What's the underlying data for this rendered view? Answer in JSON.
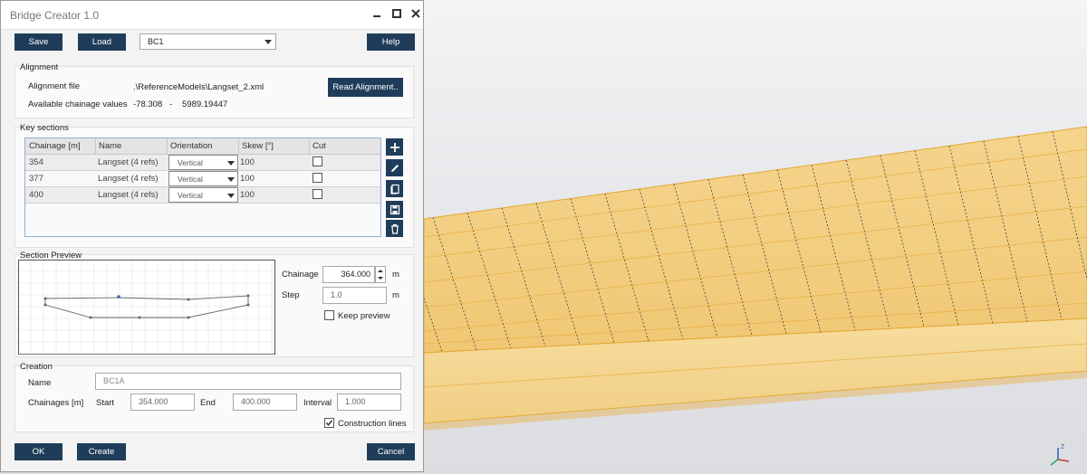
{
  "window": {
    "title": "Bridge Creator 1.0"
  },
  "toolbar": {
    "save_label": "Save",
    "load_label": "Load",
    "preset_value": "BC1",
    "help_label": "Help"
  },
  "alignment": {
    "group_label": "Alignment",
    "file_label": "Alignment file",
    "file_value": ".\\ReferenceModels\\Langset_2.xml",
    "chainage_label": "Available chainage values",
    "chainage_min": "-78.308",
    "chainage_sep": "-",
    "chainage_max": "5989.19447",
    "read_button": "Read Alignment.."
  },
  "key_sections": {
    "group_label": "Key sections",
    "columns": [
      "Chainage [m]",
      "Name",
      "Orientation",
      "Skew [°]",
      "Cut"
    ],
    "rows": [
      {
        "chainage": "354",
        "name": "Langset (4 refs)",
        "orientation": "Vertical",
        "skew": "100",
        "cut": false
      },
      {
        "chainage": "377",
        "name": "Langset (4 refs)",
        "orientation": "Vertical",
        "skew": "100",
        "cut": false
      },
      {
        "chainage": "400",
        "name": "Langset (4 refs)",
        "orientation": "Vertical",
        "skew": "100",
        "cut": false
      }
    ],
    "side_buttons": [
      "plus-icon",
      "pencil-icon",
      "copy-icon",
      "save-icon",
      "trash-icon"
    ]
  },
  "preview": {
    "group_label": "Section Preview",
    "chainage_label": "Chainage",
    "chainage_value": "364.000",
    "chainage_unit": "m",
    "step_label": "Step",
    "step_value": "1.0",
    "step_unit": "m",
    "keep_preview_label": "Keep preview",
    "keep_preview_checked": false
  },
  "creation": {
    "group_label": "Creation",
    "name_label": "Name",
    "name_value": "BC1A",
    "chainages_label": "Chainages [m]",
    "start_label": "Start",
    "start_value": "354.000",
    "end_label": "End",
    "end_value": "400.000",
    "interval_label": "Interval",
    "interval_value": "1.000",
    "construction_lines_label": "Construction lines",
    "construction_lines_checked": true
  },
  "footer": {
    "ok_label": "OK",
    "create_label": "Create",
    "cancel_label": "Cancel"
  },
  "colors": {
    "button": "#1f3d5a",
    "deck_fill": "#f3cd7c",
    "deck_edge": "#e2a832",
    "table_border": "#8fb1d5"
  }
}
